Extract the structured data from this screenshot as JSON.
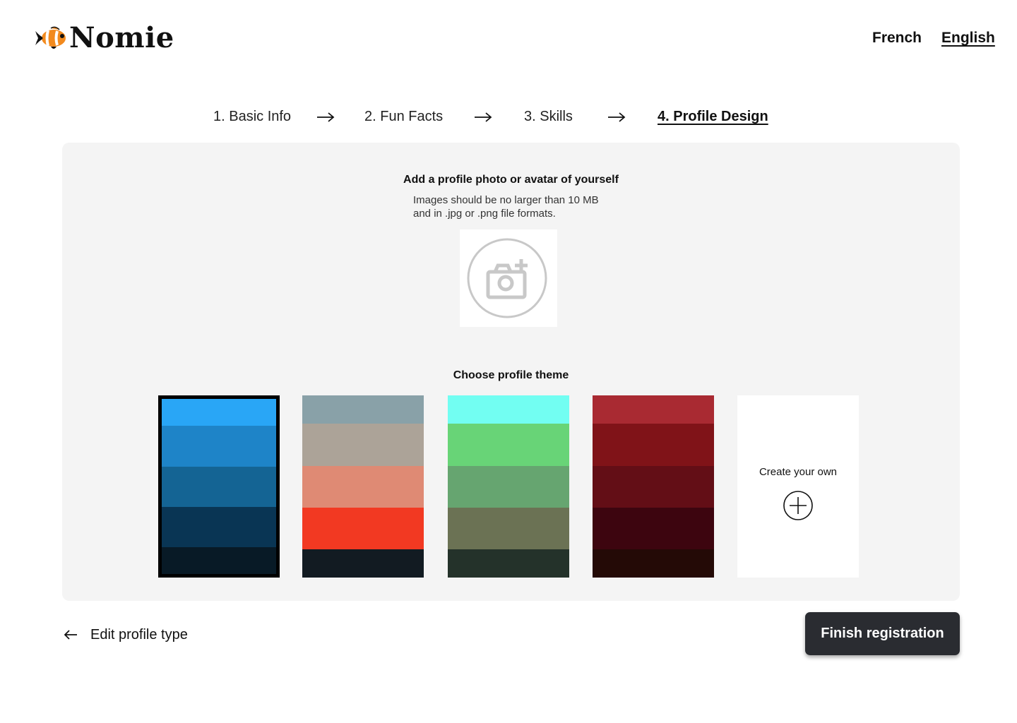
{
  "header": {
    "logo_text": "Nomie",
    "languages": [
      {
        "label": "French",
        "active": false
      },
      {
        "label": "English",
        "active": true
      }
    ]
  },
  "steps": [
    {
      "label": "1. Basic Info",
      "active": false
    },
    {
      "label": "2. Fun Facts",
      "active": false
    },
    {
      "label": "3. Skills",
      "active": false
    },
    {
      "label": "4. Profile Design",
      "active": true
    }
  ],
  "photo": {
    "title": "Add a profile photo or avatar of yourself",
    "hint_line1": "Images should be no larger than 10 MB",
    "hint_line2": "and in .jpg or .png file formats.",
    "icon": "camera-add-icon"
  },
  "themes": {
    "title": "Choose profile theme",
    "selected_index": 0,
    "options": [
      {
        "name": "blue",
        "colors": [
          "#29a6f6",
          "#1e84c8",
          "#146494",
          "#093554",
          "#081a26"
        ]
      },
      {
        "name": "coral",
        "colors": [
          "#89a1a8",
          "#aca398",
          "#df8a74",
          "#f23922",
          "#121b22"
        ]
      },
      {
        "name": "green",
        "colors": [
          "#72fef2",
          "#68d477",
          "#66a570",
          "#6b7254",
          "#24322a"
        ]
      },
      {
        "name": "crimson",
        "colors": [
          "#a92a32",
          "#801318",
          "#630e16",
          "#3d050f",
          "#240a06"
        ]
      }
    ],
    "create_own_label": "Create your own"
  },
  "footer": {
    "back_label": "Edit profile type",
    "finish_label": "Finish registration"
  },
  "colors": {
    "panel_bg": "#f4f4f4",
    "button_bg": "#2a2c31",
    "fish_orange": "#f28a1e"
  }
}
